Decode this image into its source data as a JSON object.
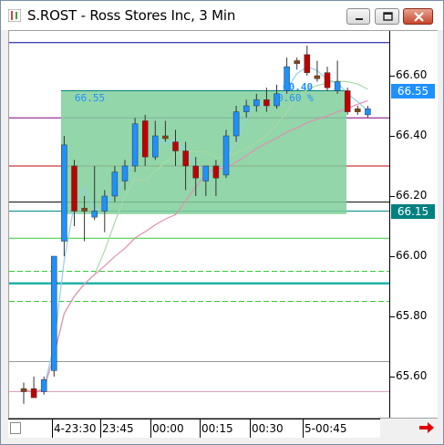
{
  "window": {
    "title": "S.ROST - Ross Stores Inc, 3 Min",
    "buttons": {
      "minimize": "minimize",
      "maximize": "maximize",
      "close": "close"
    }
  },
  "chart_data": {
    "type": "candlestick",
    "title": "S.ROST - Ross Stores Inc, 3 Min",
    "ylim": [
      65.5,
      66.8
    ],
    "y_ticks": [
      "66.60",
      "66.40",
      "66.20",
      "66.00",
      "65.80",
      "65.60"
    ],
    "x_ticks": [
      "4-23:30",
      "23:45",
      "00:00",
      "00:15",
      "00:30",
      "5-00:45"
    ],
    "last_price": "66.55",
    "line_price": "66.15",
    "box": {
      "left_label": "66.55",
      "right_label": "60.40",
      "percent_label": "0.60 %"
    },
    "candles": [
      {
        "o": 65.55,
        "h": 65.58,
        "l": 65.51,
        "c": 65.56
      },
      {
        "o": 65.56,
        "h": 65.6,
        "l": 65.54,
        "c": 65.53
      },
      {
        "o": 65.55,
        "h": 65.6,
        "l": 65.54,
        "c": 65.59
      },
      {
        "o": 65.62,
        "h": 66.0,
        "l": 65.6,
        "c": 66.0
      },
      {
        "o": 66.05,
        "h": 66.4,
        "l": 66.0,
        "c": 66.37
      },
      {
        "o": 66.3,
        "h": 66.32,
        "l": 66.1,
        "c": 66.15
      },
      {
        "o": 66.15,
        "h": 66.2,
        "l": 66.05,
        "c": 66.16
      },
      {
        "o": 66.13,
        "h": 66.3,
        "l": 66.12,
        "c": 66.15
      },
      {
        "o": 66.15,
        "h": 66.22,
        "l": 66.08,
        "c": 66.2
      },
      {
        "o": 66.2,
        "h": 66.3,
        "l": 66.18,
        "c": 66.28
      },
      {
        "o": 66.25,
        "h": 66.32,
        "l": 66.22,
        "c": 66.3
      },
      {
        "o": 66.3,
        "h": 66.46,
        "l": 66.28,
        "c": 66.44
      },
      {
        "o": 66.45,
        "h": 66.47,
        "l": 66.3,
        "c": 66.33
      },
      {
        "o": 66.33,
        "h": 66.45,
        "l": 66.32,
        "c": 66.4
      },
      {
        "o": 66.4,
        "h": 66.45,
        "l": 66.38,
        "c": 66.4
      },
      {
        "o": 66.38,
        "h": 66.42,
        "l": 66.3,
        "c": 66.35
      },
      {
        "o": 66.35,
        "h": 66.38,
        "l": 66.22,
        "c": 66.3
      },
      {
        "o": 66.3,
        "h": 66.33,
        "l": 66.2,
        "c": 66.26
      },
      {
        "o": 66.25,
        "h": 66.3,
        "l": 66.2,
        "c": 66.3
      },
      {
        "o": 66.3,
        "h": 66.32,
        "l": 66.2,
        "c": 66.26
      },
      {
        "o": 66.27,
        "h": 66.42,
        "l": 66.26,
        "c": 66.4
      },
      {
        "o": 66.4,
        "h": 66.5,
        "l": 66.38,
        "c": 66.48
      },
      {
        "o": 66.48,
        "h": 66.52,
        "l": 66.46,
        "c": 66.5
      },
      {
        "o": 66.5,
        "h": 66.54,
        "l": 66.48,
        "c": 66.52
      },
      {
        "o": 66.52,
        "h": 66.56,
        "l": 66.48,
        "c": 66.5
      },
      {
        "o": 66.5,
        "h": 66.57,
        "l": 66.49,
        "c": 66.54
      },
      {
        "o": 66.55,
        "h": 66.66,
        "l": 66.54,
        "c": 66.63
      },
      {
        "o": 66.64,
        "h": 66.66,
        "l": 66.62,
        "c": 66.65
      },
      {
        "o": 66.67,
        "h": 66.7,
        "l": 66.6,
        "c": 66.61
      },
      {
        "o": 66.6,
        "h": 66.65,
        "l": 66.58,
        "c": 66.59
      },
      {
        "o": 66.61,
        "h": 66.63,
        "l": 66.55,
        "c": 66.56
      },
      {
        "o": 66.55,
        "h": 66.65,
        "l": 66.54,
        "c": 66.58
      },
      {
        "o": 66.55,
        "h": 66.56,
        "l": 66.47,
        "c": 66.48
      },
      {
        "o": 66.49,
        "h": 66.5,
        "l": 66.47,
        "c": 66.48
      },
      {
        "o": 66.47,
        "h": 66.5,
        "l": 66.46,
        "c": 66.49
      }
    ],
    "levels": [
      {
        "price": 66.71,
        "color": "#0000a0"
      },
      {
        "price": 66.46,
        "color": "#800080"
      },
      {
        "price": 66.3,
        "color": "#c00000"
      },
      {
        "price": 66.18,
        "color": "#000000"
      },
      {
        "price": 66.15,
        "color": "#008b8b"
      },
      {
        "price": 66.06,
        "color": "#33cc33"
      },
      {
        "price": 65.95,
        "color": "#33cc33",
        "dashed": true
      },
      {
        "price": 65.91,
        "color": "#20b2aa",
        "thick": true
      },
      {
        "price": 65.85,
        "color": "#33cc33",
        "dashed": true
      },
      {
        "price": 65.65,
        "color": "#999999"
      },
      {
        "price": 65.55,
        "color": "#e0a0c0"
      }
    ],
    "colors": {
      "up": "#1e90ff",
      "down": "#c00000",
      "doji": "#8b4513",
      "box": "#7fcf9a",
      "last_tag": "#1e90ff",
      "line_tag": "#008080"
    }
  }
}
